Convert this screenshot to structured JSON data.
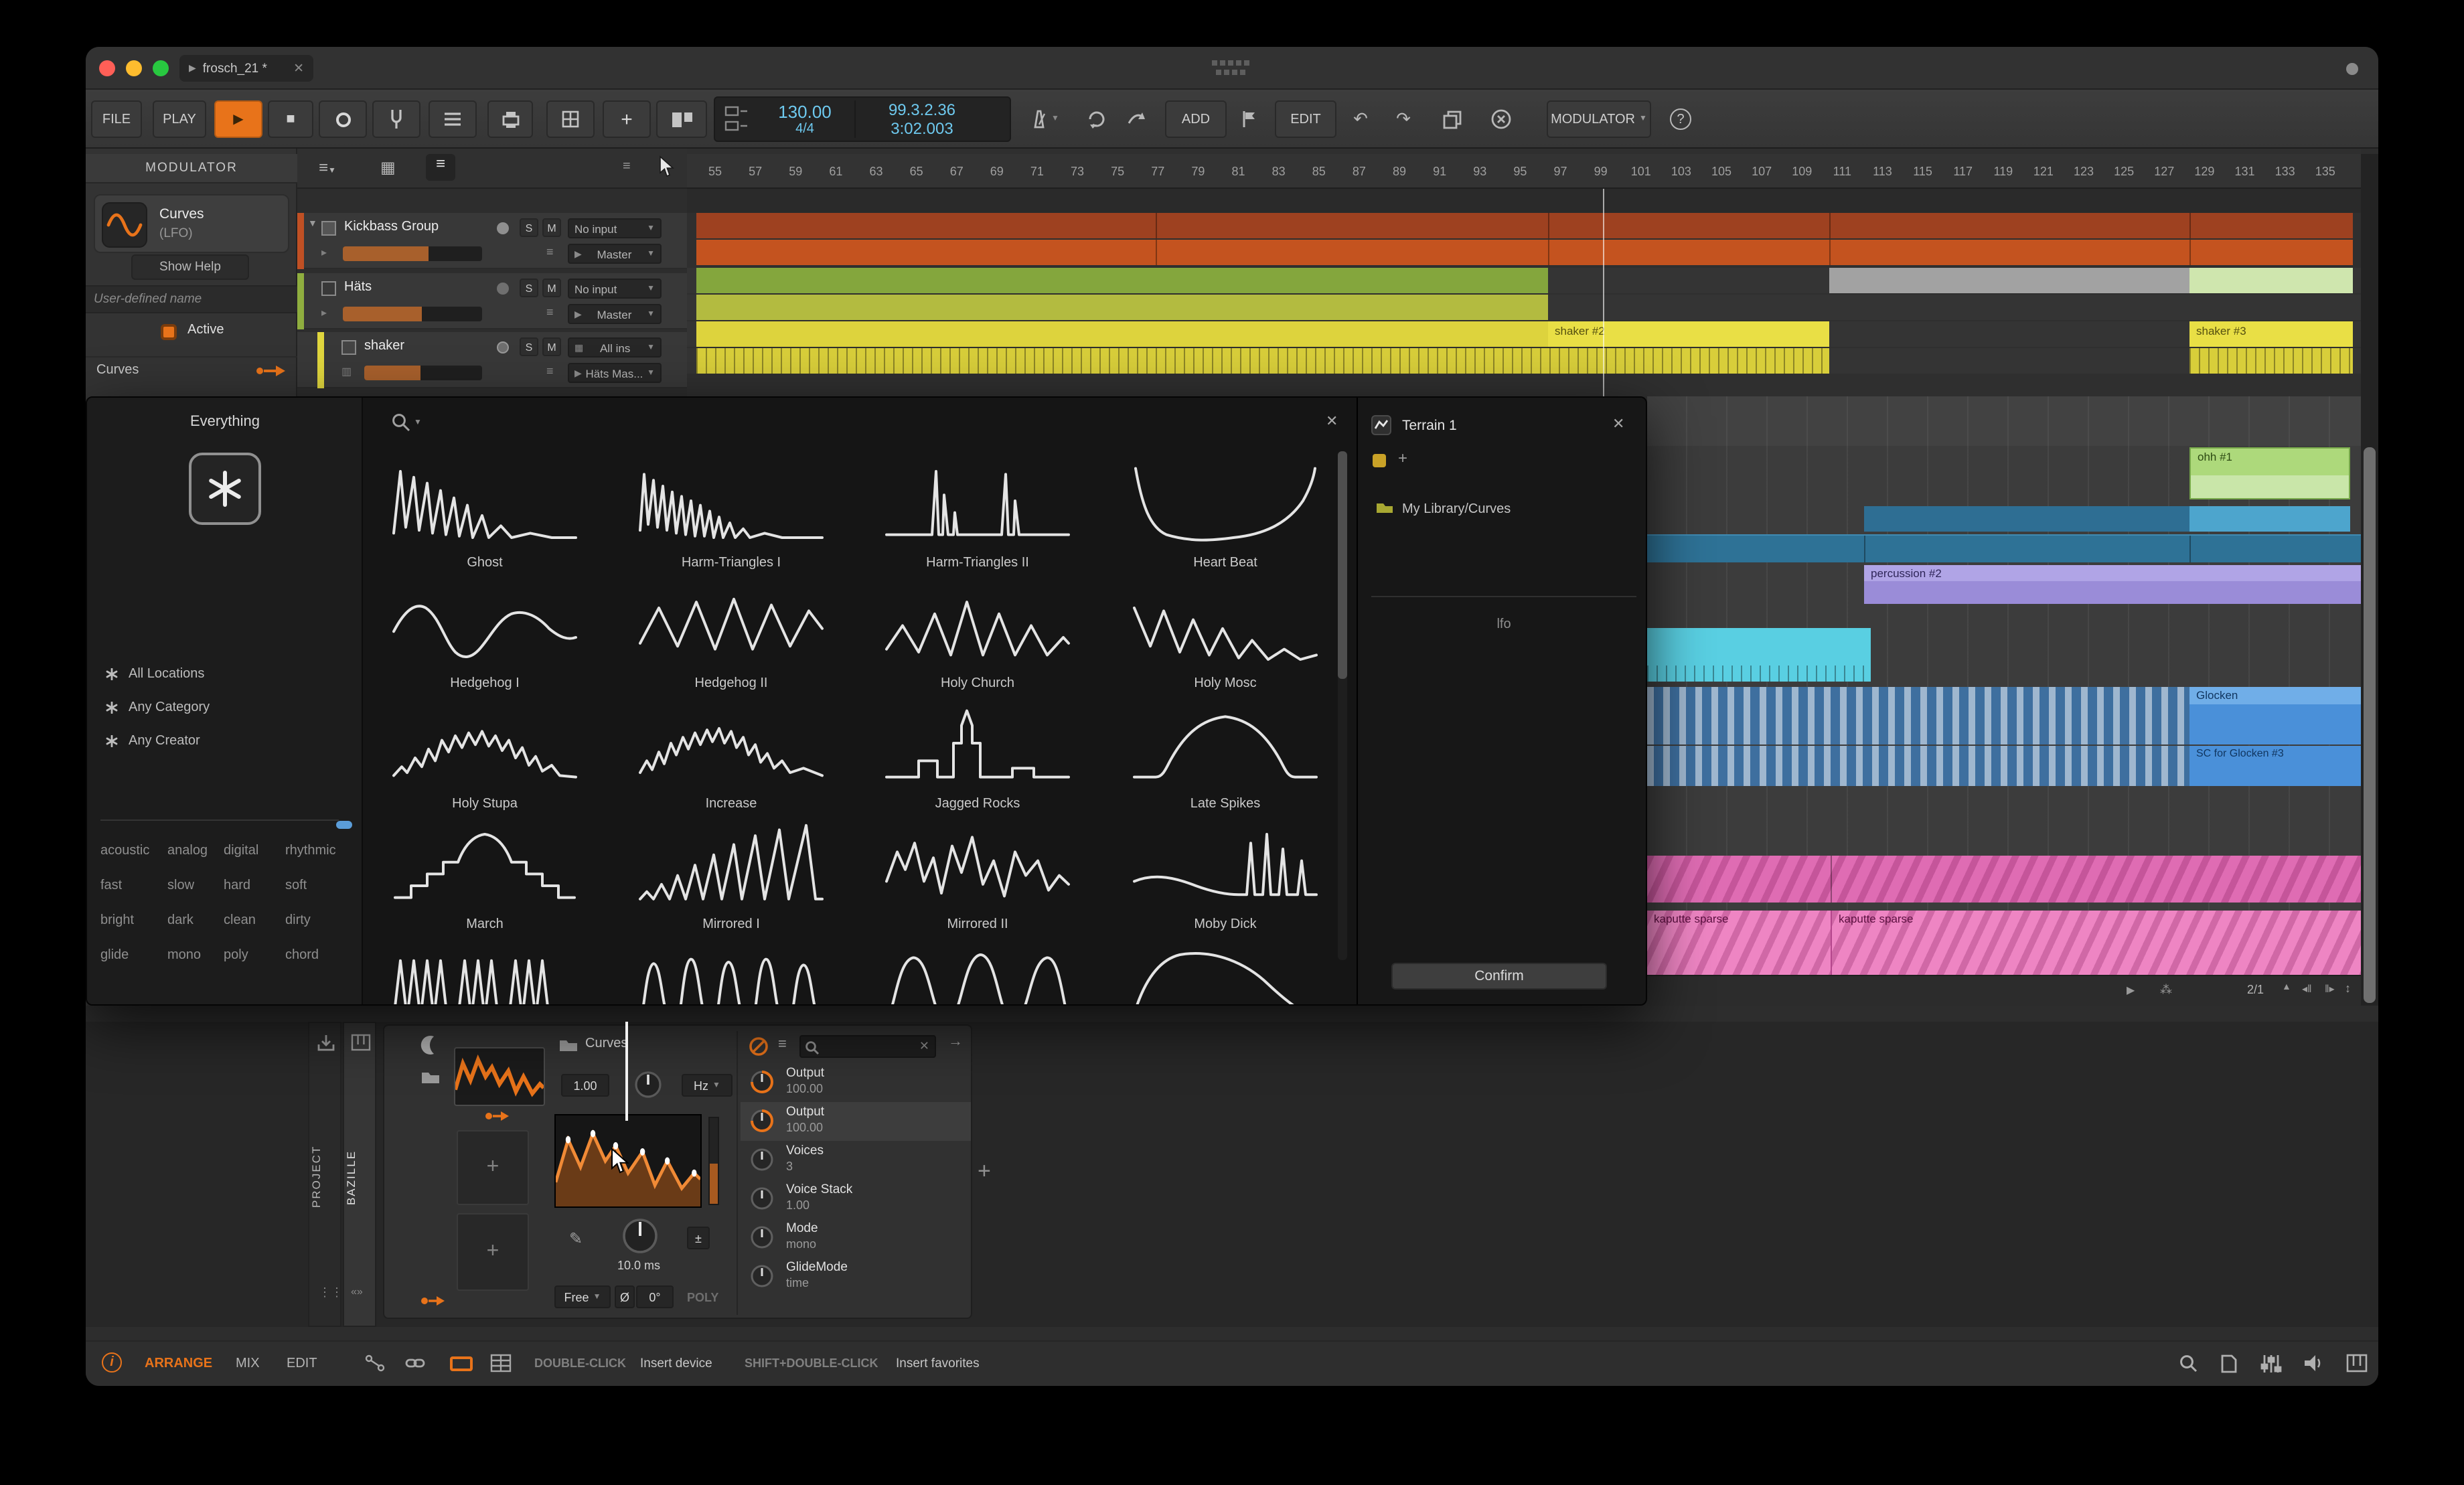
{
  "titlebar": {
    "tab_title": "frosch_21 *"
  },
  "toolbar": {
    "file": "FILE",
    "play": "PLAY",
    "add": "ADD",
    "edit": "EDIT",
    "modulator": "MODULATOR",
    "help": "?",
    "transport": {
      "tempo": "130.00",
      "time_signature": "4/4",
      "position": "99.3.2.36",
      "time": "3:02.003"
    }
  },
  "modulator_panel": {
    "header": "MODULATOR",
    "device_name": "Curves",
    "device_type": "(LFO)",
    "show_help": "Show Help",
    "name_placeholder": "User-defined name",
    "active_label": "Active",
    "source_label": "Curves"
  },
  "tracks": [
    {
      "name": "Kickbass Group",
      "input": "No input",
      "output": "Master"
    },
    {
      "name": "Häts",
      "input": "No input",
      "output": "Master"
    },
    {
      "name": "shaker",
      "input": "All ins",
      "output": "Häts Mas..."
    }
  ],
  "ruler": {
    "first": 55,
    "last": 135,
    "step": 2
  },
  "clips": {
    "shaker2": "shaker #2",
    "shaker3": "shaker #3",
    "ohh1": "ohh #1",
    "percussion2": "percussion #2",
    "glocken": "Glocken",
    "sc_glocken": "SC for Glocken #3",
    "kaputte1": "kaputte sparse",
    "kaputte2": "kaputte sparse"
  },
  "arranger_footer": {
    "zoom_ratio": "2/1"
  },
  "browser": {
    "scope": "Everything",
    "filters": [
      "All Locations",
      "Any Category",
      "Any Creator"
    ],
    "tags": [
      "acoustic",
      "analog",
      "digital",
      "rhythmic",
      "fast",
      "slow",
      "hard",
      "soft",
      "bright",
      "dark",
      "clean",
      "dirty",
      "glide",
      "mono",
      "poly",
      "chord"
    ],
    "top_row_shapes": [
      "decay-saw",
      "dense-saw",
      "twin-spikes",
      "bathtub"
    ],
    "presets": [
      {
        "name": "Ghost",
        "shape": "ghost"
      },
      {
        "name": "Harm-Triangles I",
        "shape": "harm-tri-1"
      },
      {
        "name": "Harm-Triangles II",
        "shape": "harm-tri-2"
      },
      {
        "name": "Heart Beat",
        "shape": "heartbeat"
      },
      {
        "name": "Hedgehog I",
        "shape": "hedgehog-1"
      },
      {
        "name": "Hedgehog II",
        "shape": "hedgehog-2"
      },
      {
        "name": "Holy Church",
        "shape": "church"
      },
      {
        "name": "Holy Mosc",
        "shape": "mosque"
      },
      {
        "name": "Holy Stupa",
        "shape": "stupa"
      },
      {
        "name": "Increase",
        "shape": "increase"
      },
      {
        "name": "Jagged Rocks",
        "shape": "jagged"
      },
      {
        "name": "Late Spikes",
        "shape": "late-spikes"
      },
      {
        "name": "March",
        "shape": "march"
      },
      {
        "name": "Mirrored I",
        "shape": "mirrored-1"
      },
      {
        "name": "Mirrored II",
        "shape": "mirrored-2"
      },
      {
        "name": "Moby Dick",
        "shape": "moby"
      }
    ]
  },
  "terrain": {
    "title": "Terrain 1",
    "location": "My Library/Curves",
    "tag": "lfo",
    "confirm": "Confirm"
  },
  "device_panel": {
    "tabs": [
      "PROJECT",
      "BAZILLE"
    ],
    "device_title": "Curves",
    "rate": "1.00",
    "rate_unit": "Hz",
    "delay": "10.0 ms",
    "sync": "Free",
    "phase_sign": "Ø",
    "phase": "0°",
    "poly": "POLY",
    "params": [
      {
        "name": "Output",
        "value": "100.00"
      },
      {
        "name": "Output",
        "value": "100.00"
      },
      {
        "name": "Voices",
        "value": "3"
      },
      {
        "name": "Voice Stack",
        "value": "1.00"
      },
      {
        "name": "Mode",
        "value": "mono"
      },
      {
        "name": "GlideMode",
        "value": "time"
      }
    ]
  },
  "statusbar": {
    "views": [
      "ARRANGE",
      "MIX",
      "EDIT"
    ],
    "hints": [
      {
        "key": "DOUBLE-CLICK",
        "action": "Insert device"
      },
      {
        "key": "SHIFT+DOUBLE-CLICK",
        "action": "Insert favorites"
      }
    ]
  },
  "colors": {
    "accent": "#e8731a",
    "transport_text": "#6ec9ef"
  }
}
